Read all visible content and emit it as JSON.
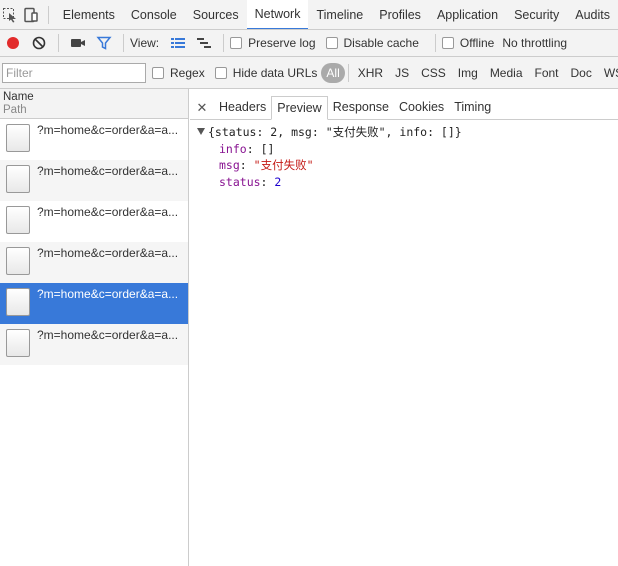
{
  "devtools": {
    "tabs": [
      {
        "label": "Elements",
        "active": false
      },
      {
        "label": "Console",
        "active": false
      },
      {
        "label": "Sources",
        "active": false
      },
      {
        "label": "Network",
        "active": true
      },
      {
        "label": "Timeline",
        "active": false
      },
      {
        "label": "Profiles",
        "active": false
      },
      {
        "label": "Application",
        "active": false
      },
      {
        "label": "Security",
        "active": false
      },
      {
        "label": "Audits",
        "active": false
      }
    ]
  },
  "toolbar": {
    "view_label": "View:",
    "preserve_log": "Preserve log",
    "disable_cache": "Disable cache",
    "offline": "Offline",
    "throttling": "No throttling"
  },
  "filter": {
    "placeholder": "Filter",
    "regex": "Regex",
    "hide_data_urls": "Hide data URLs",
    "types": [
      "All",
      "XHR",
      "JS",
      "CSS",
      "Img",
      "Media",
      "Font",
      "Doc",
      "WS"
    ]
  },
  "request_list": {
    "header_name": "Name",
    "header_path": "Path",
    "rows": [
      {
        "name": "?m=home&c=order&a=a...",
        "selected": false
      },
      {
        "name": "?m=home&c=order&a=a...",
        "selected": false
      },
      {
        "name": "?m=home&c=order&a=a...",
        "selected": false
      },
      {
        "name": "?m=home&c=order&a=a...",
        "selected": false
      },
      {
        "name": "?m=home&c=order&a=a...",
        "selected": true
      },
      {
        "name": "?m=home&c=order&a=a...",
        "selected": false
      }
    ]
  },
  "detail_tabs": [
    "Headers",
    "Preview",
    "Response",
    "Cookies",
    "Timing"
  ],
  "preview": {
    "summary": "{status: 2, msg: \"支付失败\", info: []}",
    "props": [
      {
        "key": "info",
        "value": "[]",
        "kind": "plain"
      },
      {
        "key": "msg",
        "value": "\"支付失败\"",
        "kind": "str"
      },
      {
        "key": "status",
        "value": "2",
        "kind": "num"
      }
    ]
  },
  "colors": {
    "accent": "#3879d9",
    "record": "#e22b2b",
    "filter_icon": "#3879d9"
  }
}
